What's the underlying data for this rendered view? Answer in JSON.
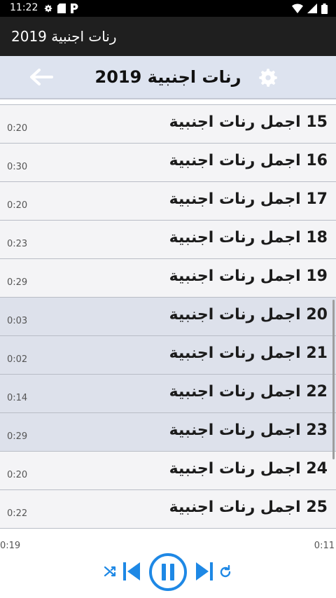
{
  "status_bar": {
    "time": "11:22",
    "icons_left": [
      "gear-icon",
      "sd-card-icon",
      "parking-icon"
    ],
    "icons_right": [
      "wifi-icon",
      "signal-icon",
      "battery-icon"
    ]
  },
  "app_bar": {
    "title": "رنات اجنبية 2019"
  },
  "header": {
    "title": "رنات اجنبية 2019",
    "back_icon": "arrow-left-icon",
    "settings_icon": "gear-icon"
  },
  "tracks": [
    {
      "title": "15 اجمل رنات اجنبية",
      "duration": "0:20"
    },
    {
      "title": "16 اجمل رنات اجنبية",
      "duration": "0:30"
    },
    {
      "title": "17 اجمل رنات اجنبية",
      "duration": "0:20"
    },
    {
      "title": "18 اجمل رنات اجنبية",
      "duration": "0:23"
    },
    {
      "title": "19 اجمل رنات اجنبية",
      "duration": "0:29"
    },
    {
      "title": "20 اجمل رنات اجنبية",
      "duration": "0:03"
    },
    {
      "title": "21 اجمل رنات اجنبية",
      "duration": "0:02"
    },
    {
      "title": "22 اجمل رنات اجنبية",
      "duration": "0:14"
    },
    {
      "title": "23 اجمل رنات اجنبية",
      "duration": "0:29"
    },
    {
      "title": "24 اجمل رنات اجنبية",
      "duration": "0:20"
    },
    {
      "title": "25 اجمل رنات اجنبية",
      "duration": "0:22"
    }
  ],
  "player": {
    "elapsed": "0:19",
    "total": "0:11",
    "controls": [
      "shuffle-icon",
      "skip-previous-icon",
      "pause-icon",
      "skip-next-icon",
      "repeat-icon"
    ],
    "accent_color": "#1e88e5"
  }
}
